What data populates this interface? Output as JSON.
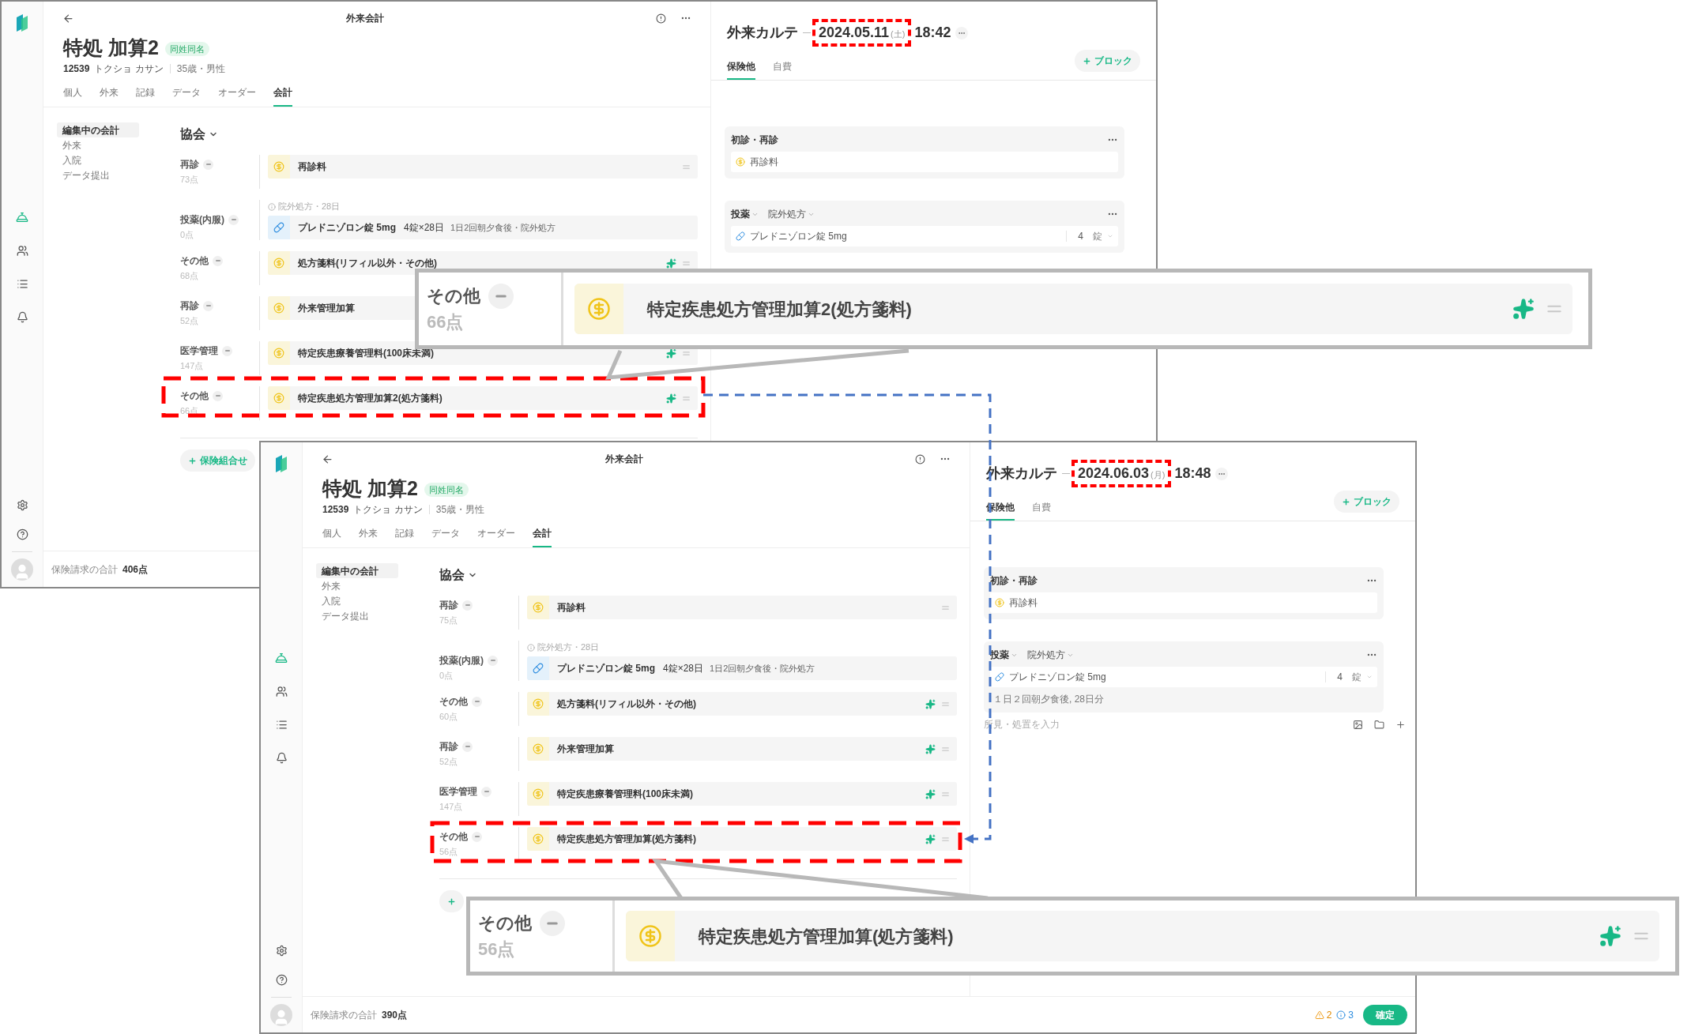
{
  "windows": [
    {
      "header_title": "外来会計",
      "patient": {
        "name": "特処 加算2",
        "badge": "同姓同名",
        "id": "12539",
        "kana": "トクショ カサン",
        "info": "35歳・男性"
      },
      "tabs": [
        {
          "label": "個人",
          "selected": false
        },
        {
          "label": "外来",
          "selected": false
        },
        {
          "label": "記録",
          "selected": false
        },
        {
          "label": "データ",
          "selected": false
        },
        {
          "label": "オーダー",
          "selected": false
        },
        {
          "label": "会計",
          "selected": true
        }
      ],
      "nav": [
        {
          "label": "編集中の会計",
          "selected": true
        },
        {
          "label": "外来",
          "selected": false
        },
        {
          "label": "入院",
          "selected": false
        },
        {
          "label": "データ提出",
          "selected": false
        }
      ],
      "insurer": "協会",
      "rows": [
        {
          "kind": "fee",
          "category": "再診",
          "points": "73点",
          "name": "再診料",
          "ai": false
        },
        {
          "kind": "drug",
          "category": "投薬(内服)",
          "points": "0点",
          "note": "院外処方・28日",
          "name": "プレドニゾロン錠 5mg",
          "dose": "4錠×28日",
          "detail": "1日2回朝夕食後・院外処方",
          "ai": false
        },
        {
          "kind": "fee",
          "category": "その他",
          "points": "68点",
          "name": "処方箋料(リフィル以外・その他)",
          "ai": true
        },
        {
          "kind": "fee",
          "category": "再診",
          "points": "52点",
          "name": "外来管理加算"
        },
        {
          "kind": "fee",
          "category": "医学管理",
          "points": "147点",
          "name": "特定疾患療養管理料(100床未満)",
          "ai": true
        },
        {
          "kind": "fee",
          "category": "その他",
          "points": "66点",
          "name": "特定疾患処方管理加算2(処方箋料)",
          "ai": true
        }
      ],
      "add_button": "保険組合せ",
      "footer": {
        "label": "保険請求の合計",
        "total": "406点"
      },
      "chart": {
        "title": "外来カルテ",
        "date": "2024.05.11",
        "weekday": "(土)",
        "time": "18:42",
        "tabs": [
          {
            "label": "保険他",
            "selected": true
          },
          {
            "label": "自費",
            "selected": false
          }
        ],
        "add_block": "ブロック",
        "cards": [
          {
            "kind": "fee",
            "title": "初診・再診",
            "items": [
              {
                "name": "再診料"
              }
            ]
          },
          {
            "kind": "drug",
            "title": "投薬",
            "route": "院外処方",
            "items": [
              {
                "name": "プレドニゾロン錠 5mg",
                "qty": "4",
                "unit": "錠"
              }
            ]
          }
        ]
      }
    },
    {
      "header_title": "外来会計",
      "patient": {
        "name": "特処 加算2",
        "badge": "同姓同名",
        "id": "12539",
        "kana": "トクショ カサン",
        "info": "35歳・男性"
      },
      "tabs": [
        {
          "label": "個人",
          "selected": false
        },
        {
          "label": "外来",
          "selected": false
        },
        {
          "label": "記録",
          "selected": false
        },
        {
          "label": "データ",
          "selected": false
        },
        {
          "label": "オーダー",
          "selected": false
        },
        {
          "label": "会計",
          "selected": true
        }
      ],
      "nav": [
        {
          "label": "編集中の会計",
          "selected": true
        },
        {
          "label": "外来",
          "selected": false
        },
        {
          "label": "入院",
          "selected": false
        },
        {
          "label": "データ提出",
          "selected": false
        }
      ],
      "insurer": "協会",
      "rows": [
        {
          "kind": "fee",
          "category": "再診",
          "points": "75点",
          "name": "再診料",
          "ai": false
        },
        {
          "kind": "drug",
          "category": "投薬(内服)",
          "points": "0点",
          "note": "院外処方・28日",
          "name": "プレドニゾロン錠 5mg",
          "dose": "4錠×28日",
          "detail": "1日2回朝夕食後・院外処方",
          "ai": false
        },
        {
          "kind": "fee",
          "category": "その他",
          "points": "60点",
          "name": "処方箋料(リフィル以外・その他)",
          "ai": true
        },
        {
          "kind": "fee",
          "category": "再診",
          "points": "52点",
          "name": "外来管理加算",
          "ai": true
        },
        {
          "kind": "fee",
          "category": "医学管理",
          "points": "147点",
          "name": "特定疾患療養管理料(100床未満)",
          "ai": true
        },
        {
          "kind": "fee",
          "category": "その他",
          "points": "56点",
          "name": "特定疾患処方管理加算(処方箋料)",
          "ai": true
        }
      ],
      "footer": {
        "label": "保険請求の合計",
        "total": "390点"
      },
      "status": {
        "warnings": "2",
        "infos": "3",
        "confirm": "確定"
      },
      "chart": {
        "title": "外来カルテ",
        "date": "2024.06.03",
        "weekday": "(月)",
        "time": "18:48",
        "tabs": [
          {
            "label": "保険他",
            "selected": true
          },
          {
            "label": "自費",
            "selected": false
          }
        ],
        "add_block": "ブロック",
        "cards": [
          {
            "kind": "fee",
            "title": "初診・再診",
            "items": [
              {
                "name": "再診料"
              }
            ]
          },
          {
            "kind": "drug",
            "title": "投薬",
            "route": "院外処方",
            "items": [
              {
                "name": "プレドニゾロン錠 5mg",
                "qty": "4",
                "unit": "錠"
              }
            ],
            "instructions": "１日２回朝夕食後, 28日分"
          }
        ],
        "memo_placeholder": "所見・処置を入力"
      }
    }
  ],
  "callouts": [
    {
      "category": "その他",
      "points": "66点",
      "name": "特定疾患処方管理加算2(処方箋料)",
      "ai": true
    },
    {
      "category": "その他",
      "points": "56点",
      "name": "特定疾患処方管理加算(処方箋料)",
      "ai": true
    }
  ]
}
